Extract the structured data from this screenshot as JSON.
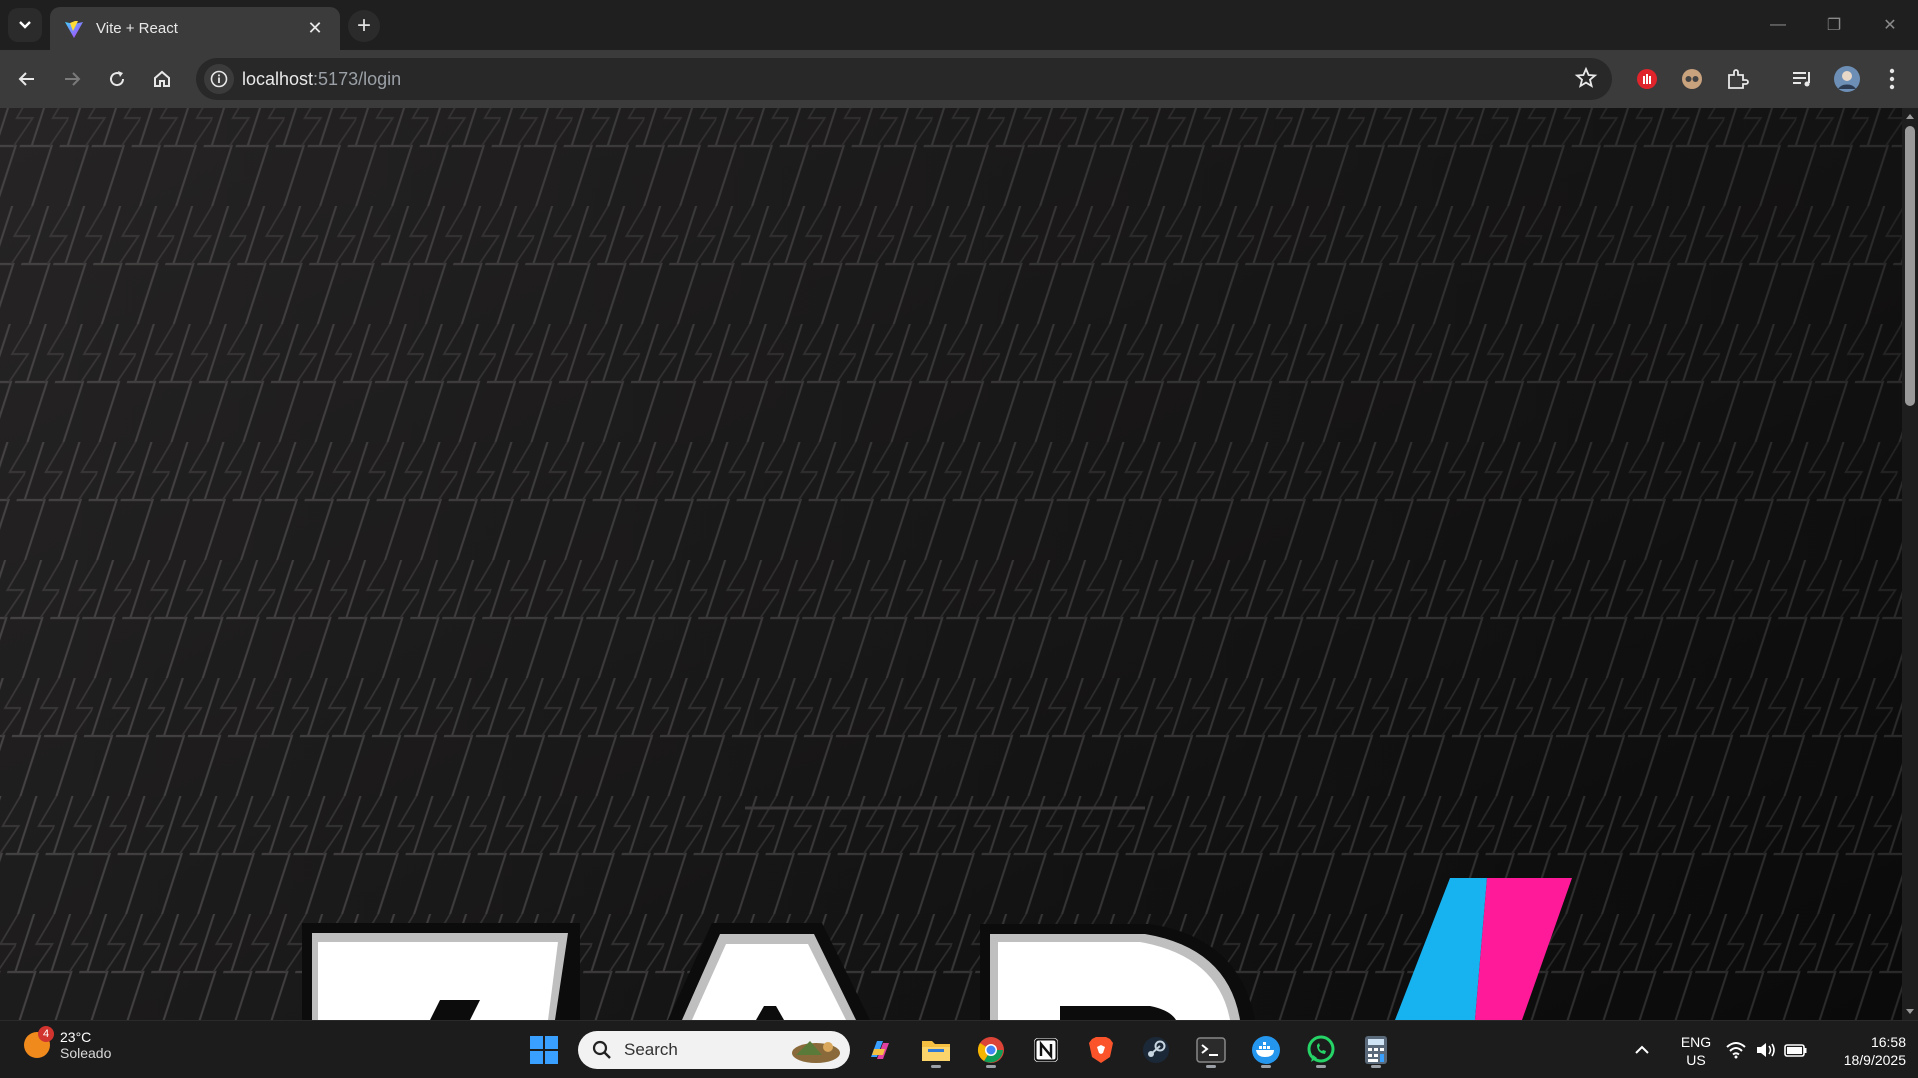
{
  "browser": {
    "tab": {
      "title": "Vite + React"
    },
    "address": {
      "host": "localhost",
      "rest": ":5173/login"
    }
  },
  "taskbar": {
    "weather": {
      "badge": "4",
      "temperature": "23°C",
      "condition": "Soleado"
    },
    "search_label": "Search",
    "language": {
      "line1": "ENG",
      "line2": "US"
    },
    "clock": {
      "time": "16:58",
      "date": "18/9/2025"
    }
  },
  "page": {
    "logo_colors": {
      "cyan": "#17b2f0",
      "magenta": "#ff1a9a"
    }
  }
}
